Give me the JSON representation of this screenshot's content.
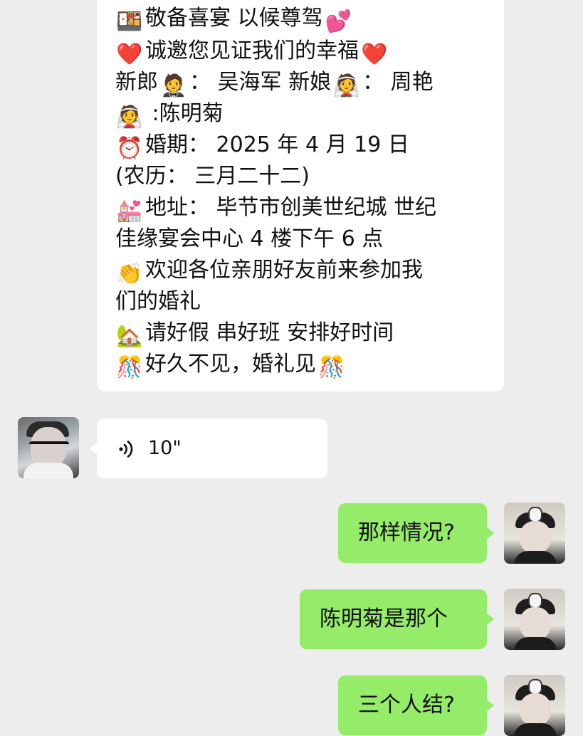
{
  "invitation": {
    "lines": [
      {
        "emoji": "🍱",
        "text": "敬备喜宴 以候尊驾",
        "trailing_emoji": "💕"
      },
      {
        "emoji": "❤️",
        "text": "诚邀您见证我们的幸福",
        "trailing_emoji": "❤️"
      },
      {
        "text_a": "新郎",
        "emoji_a": "🤵",
        "text_b": "： 吴海军  新娘",
        "emoji_b": "👰",
        "text_c": "： 周艳"
      },
      {
        "emoji": "👰",
        "text": " :陈明菊"
      },
      {
        "emoji": "⏰",
        "text": "婚期： 2025 年 4 月 19 日"
      },
      {
        "text": "(农历： 三月二十二)"
      },
      {
        "emoji": "💒",
        "text": "地址： 毕节市创美世纪城  世纪"
      },
      {
        "text": "佳缘宴会中心 4 楼下午 6 点"
      },
      {
        "emoji": "👏",
        "text": "欢迎各位亲朋好友前来参加我"
      },
      {
        "text": "们的婚礼"
      },
      {
        "emoji": "🏡",
        "text": "请好假 串好班 安排好时间"
      },
      {
        "emoji": "🎊",
        "text": "好久不见，婚礼见",
        "trailing_emoji": "🎊"
      }
    ]
  },
  "voice_message": {
    "icon": "voice-wave-icon",
    "duration": "10\""
  },
  "outgoing_messages": [
    {
      "text": "那样情况?"
    },
    {
      "text": "陈明菊是那个"
    },
    {
      "text": "三个人结?"
    }
  ],
  "colors": {
    "background": "#ededed",
    "incoming_bubble": "#ffffff",
    "outgoing_bubble": "#95ec69"
  }
}
